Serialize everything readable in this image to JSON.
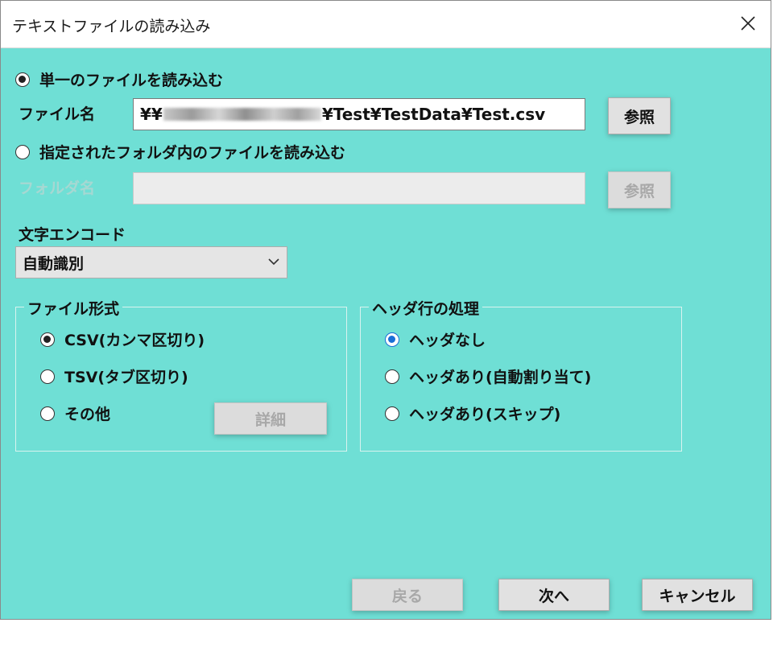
{
  "window": {
    "title": "テキストファイルの読み込み"
  },
  "source": {
    "single_file_option": "単一のファイルを読み込む",
    "single_file_selected": true,
    "file_name_label": "ファイル名",
    "file_path_prefix": "¥¥",
    "file_path_suffix": "¥Test¥TestData¥Test.csv",
    "browse_file_label": "参照",
    "folder_option": "指定されたフォルダ内のファイルを読み込む",
    "folder_selected": false,
    "folder_name_label": "フォルダ名",
    "folder_path": "",
    "browse_folder_label": "参照"
  },
  "encoding": {
    "label": "文字エンコード",
    "selected": "自動識別"
  },
  "file_format": {
    "title": "ファイル形式",
    "options": [
      {
        "label": "CSV(カンマ区切り)",
        "selected": true
      },
      {
        "label": "TSV(タブ区切り)",
        "selected": false
      },
      {
        "label": "その他",
        "selected": false
      }
    ],
    "detail_button": "詳細"
  },
  "header_handling": {
    "title": "ヘッダ行の処理",
    "options": [
      {
        "label": "ヘッダなし",
        "selected": true
      },
      {
        "label": "ヘッダあり(自動割り当て)",
        "selected": false
      },
      {
        "label": "ヘッダあり(スキップ)",
        "selected": false
      }
    ]
  },
  "footer": {
    "back_label": "戻る",
    "next_label": "次へ",
    "cancel_label": "キャンセル"
  },
  "colors": {
    "dialog_background": "#6fdfd5",
    "selected_radio_accent": "#1a6fd6"
  }
}
